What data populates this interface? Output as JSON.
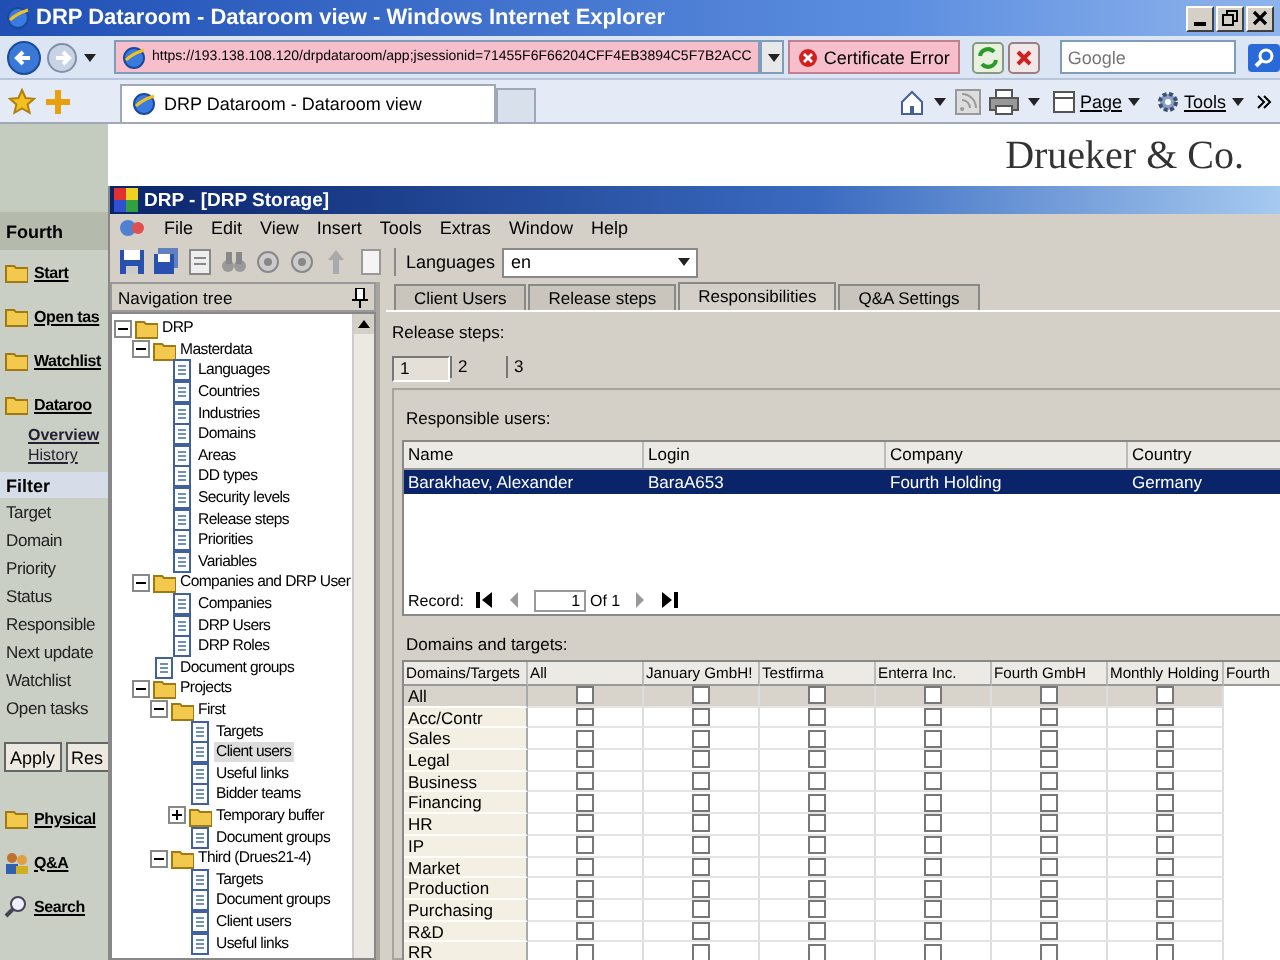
{
  "browser": {
    "title": "DRP Dataroom - Dataroom view - Windows Internet Explorer",
    "url": "https://193.138.108.120/drpdataroom/app;jsessionid=71455F6F66204CFF4EB3894C5F7B2ACC",
    "certificate_error": "Certificate Error",
    "search": {
      "placeholder": "Google"
    },
    "tab_title": "DRP Dataroom - Dataroom view",
    "commands": [
      "Page",
      "Tools"
    ]
  },
  "page": {
    "brand": "Drueker & Co.",
    "sidebar": {
      "header": "Fourth",
      "nav": [
        "Start",
        "Open tas",
        "Watchlist",
        "Dataroo"
      ],
      "subnav": [
        {
          "label": "Overview",
          "selected": true
        },
        {
          "label": "History",
          "selected": false
        }
      ],
      "filter": {
        "title": "Filter",
        "fields": [
          "Target",
          "Domain",
          "Priority",
          "Status",
          "Responsible",
          "Next update",
          "Watchlist",
          "Open tasks"
        ]
      },
      "buttons": [
        "Apply",
        "Res"
      ],
      "bottom_nav": [
        "Physical",
        "Q&A",
        "Search"
      ]
    }
  },
  "app": {
    "title": "DRP - [DRP Storage]",
    "menu": [
      "File",
      "Edit",
      "View",
      "Insert",
      "Tools",
      "Extras",
      "Window",
      "Help"
    ],
    "toolbar": {
      "language_label": "Languages",
      "language": "en"
    },
    "nav_tree": {
      "title": "Navigation tree",
      "items": [
        {
          "label": "DRP",
          "selected": false,
          "expanded": true,
          "children": [
            {
              "label": "Masterdata",
              "selected": false,
              "expanded": true,
              "children": [
                {
                  "label": "Languages",
                  "selected": false
                },
                {
                  "label": "Countries",
                  "selected": false
                },
                {
                  "label": "Industries",
                  "selected": false
                },
                {
                  "label": "Domains",
                  "selected": false
                },
                {
                  "label": "Areas",
                  "selected": false
                },
                {
                  "label": "DD types",
                  "selected": false
                },
                {
                  "label": "Security levels",
                  "selected": false
                },
                {
                  "label": "Release steps",
                  "selected": false
                },
                {
                  "label": "Priorities",
                  "selected": false
                },
                {
                  "label": "Variables",
                  "selected": false
                }
              ]
            },
            {
              "label": "Companies and DRP User",
              "selected": false,
              "expanded": true,
              "children": [
                {
                  "label": "Companies",
                  "selected": false
                },
                {
                  "label": "DRP Users",
                  "selected": false
                },
                {
                  "label": "DRP Roles",
                  "selected": false
                }
              ]
            },
            {
              "label": "Document groups",
              "selected": false
            },
            {
              "label": "Projects",
              "selected": false,
              "expanded": true,
              "children": [
                {
                  "label": "First",
                  "selected": false,
                  "expanded": true,
                  "children": [
                    {
                      "label": "Targets",
                      "selected": false
                    },
                    {
                      "label": "Client users",
                      "selected": true
                    },
                    {
                      "label": "Useful links",
                      "selected": false
                    },
                    {
                      "label": "Bidder teams",
                      "selected": false
                    },
                    {
                      "label": "Temporary buffer",
                      "selected": false,
                      "expanded": false
                    },
                    {
                      "label": "Document groups",
                      "selected": false
                    }
                  ]
                },
                {
                  "label": "Third (Drues21-4)",
                  "selected": false,
                  "expanded": true,
                  "children": [
                    {
                      "label": "Targets",
                      "selected": false
                    },
                    {
                      "label": "Document groups",
                      "selected": false
                    },
                    {
                      "label": "Client users",
                      "selected": false
                    },
                    {
                      "label": "Useful links",
                      "selected": false
                    }
                  ]
                }
              ]
            }
          ]
        }
      ]
    },
    "tabs": [
      {
        "label": "Client Users",
        "selected": false
      },
      {
        "label": "Release steps",
        "selected": false
      },
      {
        "label": "Responsibilities",
        "selected": true
      },
      {
        "label": "Q&A Settings",
        "selected": false
      }
    ],
    "release_steps": {
      "label": "Release steps:",
      "steps": [
        {
          "label": "1",
          "selected": true
        },
        {
          "label": "2",
          "selected": false
        },
        {
          "label": "3",
          "selected": false
        }
      ]
    },
    "responsible_users": {
      "label": "Responsible users:",
      "columns": [
        "Name",
        "Login",
        "Company",
        "Country"
      ],
      "rows": [
        {
          "selected": true,
          "cells": [
            "Barakhaev, Alexander",
            "BaraA653",
            "Fourth Holding",
            "Germany"
          ]
        }
      ],
      "record": {
        "label": "Record:",
        "value": "1",
        "total": "Of 1"
      }
    },
    "domains": {
      "label": "Domains and targets:",
      "columns": [
        "Domains/Targets",
        "All",
        "January GmbH!",
        "Testfirma",
        "Enterra Inc.",
        "Fourth GmbH",
        "Monthly Holding",
        "Fourth"
      ],
      "rows": [
        {
          "label": "All",
          "selected": true,
          "cells": [
            {
              "checked": false
            },
            {
              "checked": false
            },
            {
              "checked": false
            },
            {
              "checked": false
            },
            {
              "checked": false
            },
            {
              "checked": false
            }
          ]
        },
        {
          "label": "Acc/Contr",
          "selected": false,
          "cells": [
            {
              "checked": false
            },
            {
              "checked": false
            },
            {
              "checked": false
            },
            {
              "checked": false
            },
            {
              "checked": false
            },
            {
              "checked": false
            }
          ]
        },
        {
          "label": "Sales",
          "selected": false,
          "cells": [
            {
              "checked": false
            },
            {
              "checked": false
            },
            {
              "checked": false
            },
            {
              "checked": false
            },
            {
              "checked": false
            },
            {
              "checked": false
            }
          ]
        },
        {
          "label": "Legal",
          "selected": false,
          "cells": [
            {
              "checked": false
            },
            {
              "checked": false
            },
            {
              "checked": false
            },
            {
              "checked": false
            },
            {
              "checked": false
            },
            {
              "checked": false
            }
          ]
        },
        {
          "label": "Business",
          "selected": false,
          "cells": [
            {
              "checked": false
            },
            {
              "checked": false
            },
            {
              "checked": false
            },
            {
              "checked": false
            },
            {
              "checked": false
            },
            {
              "checked": false
            }
          ]
        },
        {
          "label": "Financing",
          "selected": false,
          "cells": [
            {
              "checked": false
            },
            {
              "checked": false
            },
            {
              "checked": false
            },
            {
              "checked": false
            },
            {
              "checked": false
            },
            {
              "checked": false
            }
          ]
        },
        {
          "label": "HR",
          "selected": false,
          "cells": [
            {
              "checked": false
            },
            {
              "checked": false
            },
            {
              "checked": false
            },
            {
              "checked": false
            },
            {
              "checked": false
            },
            {
              "checked": false
            }
          ]
        },
        {
          "label": "IP",
          "selected": false,
          "cells": [
            {
              "checked": false
            },
            {
              "checked": false
            },
            {
              "checked": false
            },
            {
              "checked": false
            },
            {
              "checked": false
            },
            {
              "checked": false
            }
          ]
        },
        {
          "label": "Market",
          "selected": false,
          "cells": [
            {
              "checked": false
            },
            {
              "checked": false
            },
            {
              "checked": false
            },
            {
              "checked": false
            },
            {
              "checked": false
            },
            {
              "checked": false
            }
          ]
        },
        {
          "label": "Production",
          "selected": false,
          "cells": [
            {
              "checked": false
            },
            {
              "checked": false
            },
            {
              "checked": false
            },
            {
              "checked": false
            },
            {
              "checked": false
            },
            {
              "checked": false
            }
          ]
        },
        {
          "label": "Purchasing",
          "selected": false,
          "cells": [
            {
              "checked": false
            },
            {
              "checked": false
            },
            {
              "checked": false
            },
            {
              "checked": false
            },
            {
              "checked": false
            },
            {
              "checked": false
            }
          ]
        },
        {
          "label": "R&D",
          "selected": false,
          "cells": [
            {
              "checked": false
            },
            {
              "checked": false
            },
            {
              "checked": false
            },
            {
              "checked": false
            },
            {
              "checked": false
            },
            {
              "checked": false
            }
          ]
        },
        {
          "label": "RR",
          "selected": false,
          "cells": [
            {
              "checked": false
            },
            {
              "checked": false
            },
            {
              "checked": false
            },
            {
              "checked": false
            },
            {
              "checked": false
            },
            {
              "checked": false
            }
          ]
        }
      ]
    }
  }
}
